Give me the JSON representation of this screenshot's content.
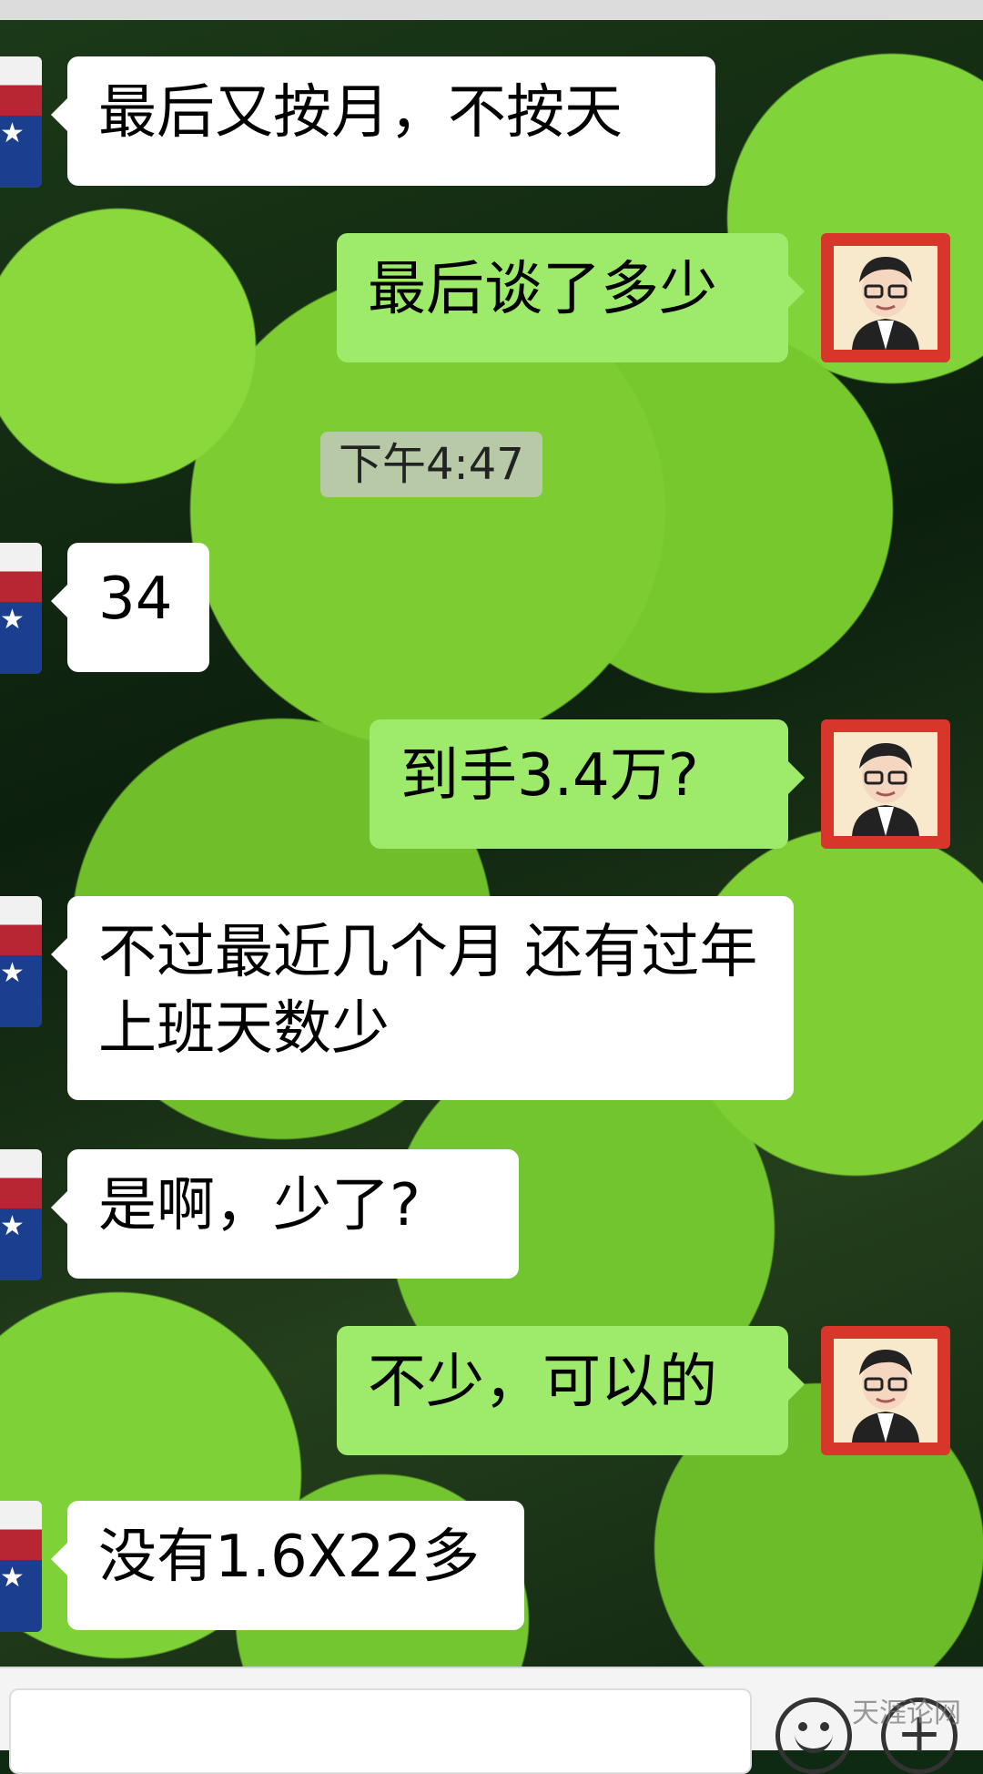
{
  "messages": [
    {
      "side": "left",
      "text": "最后又按月，不按天"
    },
    {
      "side": "right",
      "text": "最后谈了多少"
    },
    {
      "side": "left",
      "text": "34"
    },
    {
      "side": "right",
      "text": "到手3.4万?"
    },
    {
      "side": "left",
      "text": "不过最近几个月 还有过年上班天数少"
    },
    {
      "side": "left",
      "text": "是啊，少了?"
    },
    {
      "side": "right",
      "text": "不少，可以的"
    },
    {
      "side": "left",
      "text": "没有1.6X22多"
    }
  ],
  "timestamp": "下午4:47",
  "input_bar": {
    "emoji_icon": "smiley-face-icon",
    "plus_icon": "plus-circle-icon",
    "plus_glyph": "+"
  },
  "watermark": "天涯论网",
  "colors": {
    "sent_bubble": "#9eea6a",
    "received_bubble": "#ffffff",
    "timestamp_bg": "#c8c8c8"
  }
}
